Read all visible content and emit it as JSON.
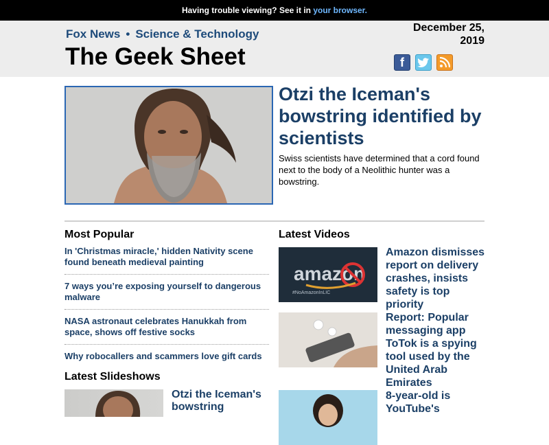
{
  "top_bar": {
    "text": "Having trouble viewing? See it in ",
    "link": "your browser."
  },
  "header": {
    "brand": "Fox News",
    "separator": "•",
    "section": "Science & Technology",
    "title": "The Geek Sheet",
    "date_line1": "December 25,",
    "date_line2": "2019",
    "social": [
      {
        "icon": "facebook-icon",
        "glyph": "f"
      },
      {
        "icon": "twitter-icon",
        "glyph": "t"
      },
      {
        "icon": "rss-icon",
        "glyph": ""
      }
    ]
  },
  "hero": {
    "title": "Otzi the Iceman's bowstring identified by scientists",
    "description": "Swiss scientists have determined that a cord found next to the body of a Neolithic hunter was a bowstring."
  },
  "most_popular": {
    "heading": "Most Popular",
    "items": [
      "In 'Christmas miracle,' hidden Nativity scene found beneath medieval painting",
      "7 ways you’re exposing yourself to dangerous malware",
      "NASA astronaut celebrates Hanukkah from space, shows off festive socks",
      "Why robocallers and scammers love gift cards"
    ]
  },
  "latest_slideshows": {
    "heading": "Latest Slideshows",
    "items": [
      {
        "title": "Otzi the Iceman's bowstring"
      }
    ]
  },
  "latest_videos": {
    "heading": "Latest Videos",
    "items": [
      {
        "title": "Amazon dismisses report on delivery crashes, insists safety is top priority",
        "thumb_text": "amazon",
        "thumb_tag": "#NoAmazonInLIC"
      },
      {
        "title": "Report: Popular messaging app ToTok is a spying tool used by the United Arab Emirates"
      },
      {
        "title": "8-year-old is YouTube's"
      }
    ]
  }
}
